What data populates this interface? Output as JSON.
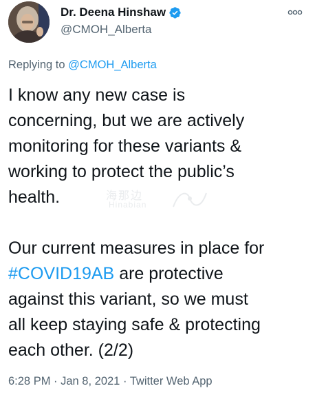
{
  "author": {
    "display_name": "Dr. Deena Hinshaw",
    "handle": "@CMOH_Alberta",
    "verified": true
  },
  "icons": {
    "verified": "verified-badge-icon",
    "more": "more-options-icon"
  },
  "reply": {
    "prefix": "Replying to",
    "mention": "@CMOH_Alberta"
  },
  "tweet": {
    "paragraph_1": [
      "I know any new case is",
      "concerning, but we are actively",
      "monitoring for these variants &",
      "working to protect the public’s",
      "health."
    ],
    "paragraph_2": {
      "line_1": "Our current measures in place for",
      "hashtag": "#COVID19AB",
      "line_2_rest": " are protective",
      "line_3": "against this variant, so we must",
      "line_4": "all keep staying safe & protecting",
      "line_5": "each other. (2/2)"
    }
  },
  "meta": {
    "time": "6:28 PM",
    "separator_1": " · ",
    "date": "Jan 8, 2021",
    "separator_2": " · ",
    "source": "Twitter Web App"
  },
  "watermark": {
    "cn": "海那边",
    "en": "Hinabian"
  },
  "colors": {
    "text": "#0f1419",
    "secondary": "#536471",
    "link": "#1d9bf0",
    "verified": "#1d9bf0"
  }
}
